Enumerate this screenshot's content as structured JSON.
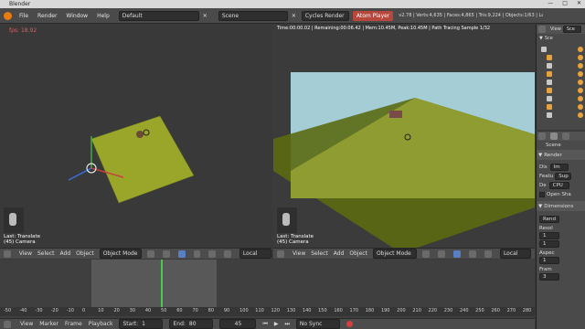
{
  "titlebar": {
    "title": "Blender"
  },
  "menubar": {
    "items": [
      "File",
      "Render",
      "Window",
      "Help"
    ],
    "layout": "Default",
    "scene": "Scene",
    "engine": "Cycles Render",
    "atom_btn": "Atom Player",
    "stats": "v2.78 | Verts:4,635 | Faces:4,865 | Tris:9,224 | Objects:1/63 | Lamps:0/1 | Mem:12.55M"
  },
  "viewport_left": {
    "fps": "fps: 18.92",
    "status": "Last: Translate",
    "object": "(45) Camera"
  },
  "viewport_right": {
    "info": "Time:00:00.02 | Remaining:00:06.42 | Mem:10.45M, Peak:10.45M | Path Tracing Sample 1/32",
    "status": "Last: Translate",
    "object": "(45) Camera"
  },
  "header_left": {
    "view": "View",
    "select": "Select",
    "add": "Add",
    "object": "Object",
    "mode": "Object Mode",
    "orientation": "Local"
  },
  "header_right": {
    "view": "View",
    "select": "Select",
    "add": "Add",
    "object": "Object",
    "mode": "Object Mode",
    "orientation": "Local"
  },
  "timeline": {
    "ruler": [
      "-50",
      "-40",
      "-30",
      "-20",
      "-10",
      "0",
      "10",
      "20",
      "30",
      "40",
      "50",
      "60",
      "70",
      "80",
      "90",
      "100",
      "110",
      "120",
      "130",
      "140",
      "150",
      "160",
      "170",
      "180",
      "190",
      "200",
      "210",
      "220",
      "230",
      "240",
      "250",
      "260",
      "270",
      "280"
    ],
    "view": "View",
    "marker": "Marker",
    "frame": "Frame",
    "playback": "Playback",
    "start_label": "Start:",
    "start": "1",
    "end_label": "End:",
    "end": "80",
    "current": "45",
    "sync": "No Sync"
  },
  "outliner": {
    "header": "View",
    "search": "Sce",
    "root": "Sce"
  },
  "properties": {
    "scene_label": "Scene",
    "render_title": "Render",
    "dev": "Dis",
    "dev_val": "Im",
    "feat": "Featu",
    "feat_val": "Sup",
    "device": "De",
    "device_val": "CPU",
    "open_sha": "Open Sha",
    "dimensions_title": "Dimensions",
    "preset": "Rend",
    "resol": "Resol",
    "asp": "Aspec",
    "fram": "Fram",
    "x": "1",
    "y": "1",
    "f": "1",
    "f2": "3"
  },
  "colors": {
    "accent": "#e8a23b",
    "red_btn": "#b8463a",
    "plane": "#9aa62a",
    "sky": "#a5cdd6"
  }
}
